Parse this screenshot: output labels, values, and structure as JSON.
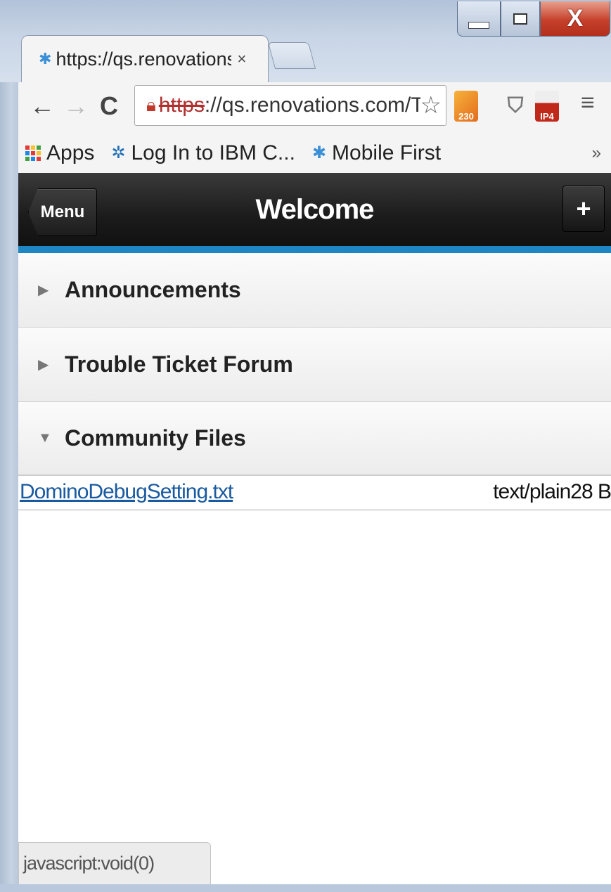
{
  "browser": {
    "tab_title": "https://qs.renovations.com",
    "tab_close": "×",
    "url_scheme": "https",
    "url_rest": "://qs.renovations.com/Ti",
    "extension_rss_count": "230",
    "extension_ip4_label": "IP4",
    "bookmarks": [
      {
        "label": "Apps",
        "icon": "apps-grid-icon"
      },
      {
        "label": "Log In to IBM C...",
        "icon": "ibm-connections-icon"
      },
      {
        "label": "Mobile First",
        "icon": "mobile-first-icon"
      }
    ],
    "bookmarks_more": "»",
    "window_close": "X"
  },
  "header": {
    "menu_label": "Menu",
    "title": "Welcome",
    "add_label": "+"
  },
  "sections": [
    {
      "label": "Announcements",
      "expanded": false
    },
    {
      "label": "Trouble Ticket Forum",
      "expanded": false
    },
    {
      "label": "Community Files",
      "expanded": true
    }
  ],
  "files": [
    {
      "name": "DominoDebugSetting.txt",
      "meta": "text/plain28 B"
    }
  ],
  "status": {
    "text": "javascript:void(0)"
  },
  "colors": {
    "accent": "#1e86c2",
    "header_bg": "#1b1b1b",
    "link": "#1a5aa0"
  }
}
